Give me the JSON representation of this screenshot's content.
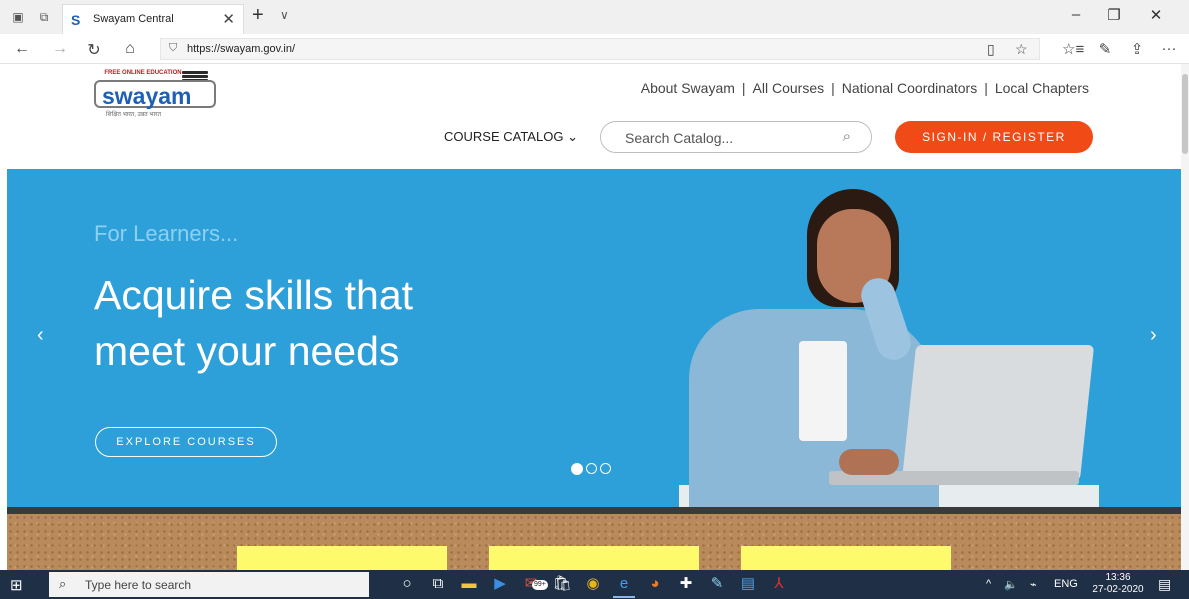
{
  "browser": {
    "tab_title": "Swayam Central",
    "tab_favicon": "S",
    "url": "https://swayam.gov.in/",
    "icons": {
      "tab_actions": "tab-actions-icon",
      "tab_aside": "set-aside-tabs-icon",
      "new_tab": "+",
      "tab_menu": "∨",
      "minimize": "–",
      "restore": "❐",
      "close": "✕",
      "back": "←",
      "forward": "→",
      "refresh": "↻",
      "home": "⌂",
      "lock": "🔒",
      "reading_view": "▯",
      "favorite": "☆",
      "favorites_bar": "☆≡",
      "pen": "✎",
      "share": "⇪",
      "more": "···"
    }
  },
  "header": {
    "logo": {
      "top_text": "FREE ONLINE EDUCATION",
      "word": "swayam",
      "tagline": "शिक्षित भारत, उन्नत भारत"
    },
    "top_links": [
      "About Swayam",
      "All Courses",
      "National Coordinators",
      "Local Chapters"
    ],
    "link_separator": "|",
    "catalog_label": "COURSE CATALOG",
    "catalog_chevron": "⌄",
    "search_placeholder": "Search Catalog...",
    "search_icon": "⌕",
    "signin_label": "SIGN-IN / REGISTER"
  },
  "hero": {
    "subtitle": "For Learners...",
    "headline": "Acquire skills that meet your needs",
    "cta": "EXPLORE COURSES",
    "prev_arrow": "‹",
    "next_arrow": "›",
    "slides_total": 3,
    "slide_active": 1
  },
  "taskbar": {
    "search_placeholder": "Type here to search",
    "start_icon": "⊞",
    "search_icon": "⌕",
    "apps": [
      {
        "name": "cortana-icon",
        "glyph": "○",
        "color": "#ffffff"
      },
      {
        "name": "task-view-icon",
        "glyph": "⧉",
        "color": "#ffffff"
      },
      {
        "name": "file-explorer-icon",
        "glyph": "▬",
        "color": "#f5c242"
      },
      {
        "name": "media-player-icon",
        "glyph": "▶",
        "color": "#3c8ee0"
      },
      {
        "name": "mail-icon",
        "glyph": "✉",
        "color": "#e0584a"
      },
      {
        "name": "store-icon",
        "glyph": "🛍",
        "color": "#ffffff"
      },
      {
        "name": "chrome-icon",
        "glyph": "◉",
        "color": "#e8b41e"
      },
      {
        "name": "edge-icon",
        "glyph": "e",
        "color": "#3aa0f0"
      },
      {
        "name": "firefox-icon",
        "glyph": "◕",
        "color": "#f07a22"
      },
      {
        "name": "vpn-icon",
        "glyph": "✚",
        "color": "#ffffff"
      },
      {
        "name": "paint-icon",
        "glyph": "✎",
        "color": "#8fd0f0"
      },
      {
        "name": "notes-icon",
        "glyph": "▤",
        "color": "#4aa0e8"
      },
      {
        "name": "acrobat-icon",
        "glyph": "⅄",
        "color": "#e0302a"
      }
    ],
    "mail_badge": "99+",
    "tray": {
      "chevron": "^",
      "volume": "🔈",
      "network": "⌁",
      "language": "ENG"
    },
    "time": "13:36",
    "date": "27-02-2020",
    "notification_icon": "▤"
  }
}
